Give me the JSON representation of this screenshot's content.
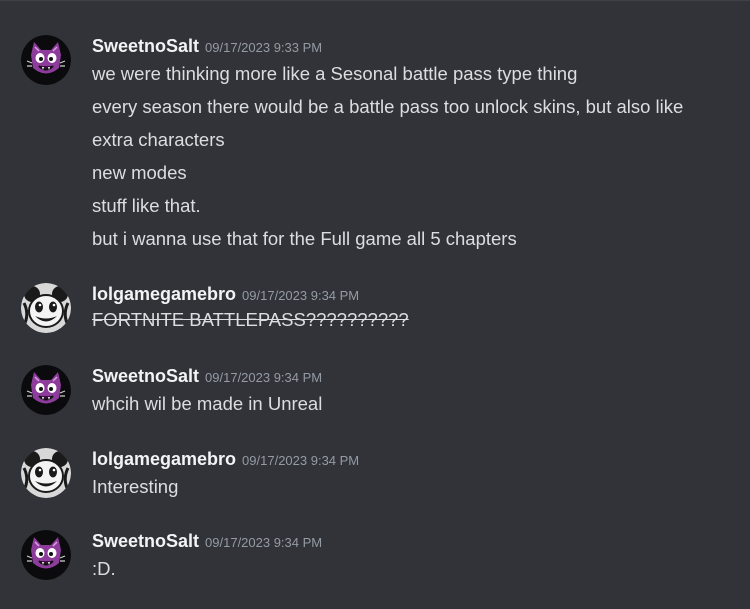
{
  "messages": [
    {
      "author": "SweetnoSalt",
      "avatar": "sweetnosalt-avatar",
      "timestamp": "09/17/2023 9:33 PM",
      "lines": [
        "we were thinking more like a Sesonal battle pass type thing",
        "every season there would be a battle pass too unlock skins, but also like",
        "extra characters",
        "new modes",
        "stuff like that.",
        "but i wanna use that for the Full game all 5 chapters"
      ]
    },
    {
      "author": "lolgamegamebro",
      "avatar": "lolgamegamebro-avatar",
      "timestamp": "09/17/2023 9:34 PM",
      "lines": [
        "FORTNITE BATTLEPASS??????????"
      ],
      "strikethrough": true
    },
    {
      "author": "SweetnoSalt",
      "avatar": "sweetnosalt-avatar",
      "timestamp": "09/17/2023 9:34 PM",
      "lines": [
        "whcih wil be made in Unreal"
      ]
    },
    {
      "author": "lolgamegamebro",
      "avatar": "lolgamegamebro-avatar",
      "timestamp": "09/17/2023 9:34 PM",
      "lines": [
        "Interesting"
      ]
    },
    {
      "author": "SweetnoSalt",
      "avatar": "sweetnosalt-avatar",
      "timestamp": "09/17/2023 9:34 PM",
      "lines": [
        ":D."
      ]
    }
  ],
  "colors": {
    "background": "#313338",
    "username": "#f2f3f5",
    "timestamp": "#949ba4",
    "message": "#dbdee1",
    "sweet_avatar_bg": "#0b0b0d",
    "sweet_avatar_cat": "#8e3c9c",
    "bro_avatar_bg": "#d8d8d8"
  }
}
